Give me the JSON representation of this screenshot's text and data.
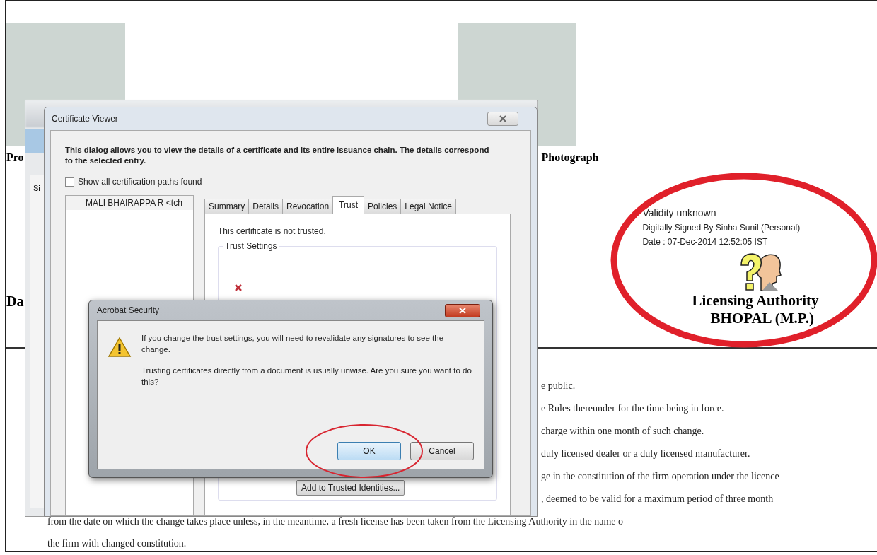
{
  "document": {
    "captions": [
      "Pro",
      "Photograph"
    ],
    "side_label": "Da",
    "signature": {
      "status": "Validity unknown",
      "signed_by": "Digitally Signed By Sinha Sunil  (Personal)",
      "date": "Date : 07-Dec-2014 12:52:05 IST",
      "authority": [
        "Licensing Authority",
        "BHOPAL (M.P.)"
      ]
    },
    "list_lines": [
      "e public.",
      "e Rules thereunder for the time being in force.",
      "charge within one month of such change.",
      "duly licensed dealer or a duly licensed manufacturer.",
      "ge in the constitution of the firm operation under the licence",
      ", deemed to be valid for a maximum period of three month"
    ],
    "closing_lines": [
      "from the date on which the change takes place unless, in the meantime, a fresh license has been taken from the Licensing Authority in the name o",
      "the firm with changed constitution."
    ]
  },
  "background_window": {
    "panel_tab": "Si"
  },
  "certificate_viewer": {
    "title": "Certificate Viewer",
    "description": "This dialog allows you to view the details of a certificate and its entire issuance chain. The details correspond to the selected entry.",
    "show_all_paths": {
      "label": "Show all certification paths found",
      "checked": false
    },
    "chain_entry": "MALI BHAIRAPPA R <tch",
    "tabs": [
      {
        "label": "Summary",
        "selected": false
      },
      {
        "label": "Details",
        "selected": false
      },
      {
        "label": "Revocation",
        "selected": false
      },
      {
        "label": "Trust",
        "selected": true
      },
      {
        "label": "Policies",
        "selected": false
      },
      {
        "label": "Legal Notice",
        "selected": false
      }
    ],
    "trust_status": "This certificate is not trusted.",
    "trust_settings_title": "Trust Settings",
    "add_button": "Add to Trusted Identities..."
  },
  "security_dialog": {
    "title": "Acrobat Security",
    "messages": [
      "If you change the trust settings, you will need to revalidate any signatures to see the change.",
      "Trusting certificates directly from a document is usually unwise. Are you sure you want to do this?"
    ],
    "buttons": [
      {
        "label": "OK",
        "default": true
      },
      {
        "label": "Cancel",
        "default": false
      }
    ]
  }
}
